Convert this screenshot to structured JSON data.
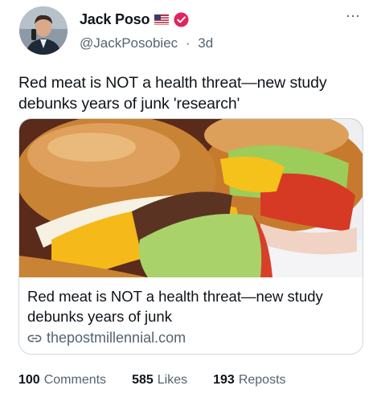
{
  "author": {
    "name": "Jack Poso",
    "handle": "@JackPosobiec",
    "separator": "·",
    "time_ago": "3d",
    "flag_icon": "us-flag-icon",
    "badge_icon": "verified-badge-icon",
    "badge_color": "#e0245e"
  },
  "more_icon": "⋯",
  "tweet": {
    "text": "Red meat is NOT a health threat—new study debunks years of junk 'research'"
  },
  "card": {
    "image_alt": "cheeseburger",
    "title": "Red meat is NOT a health threat—new study debunks years of junk",
    "domain": "thepostmillennial.com",
    "link_icon": "link-icon"
  },
  "stats": [
    {
      "value": "100",
      "label": "Comments"
    },
    {
      "value": "585",
      "label": "Likes"
    },
    {
      "value": "193",
      "label": "Reposts"
    }
  ],
  "colors": {
    "text": "#0f1419",
    "secondary": "#536471",
    "border": "#cfd9de"
  }
}
